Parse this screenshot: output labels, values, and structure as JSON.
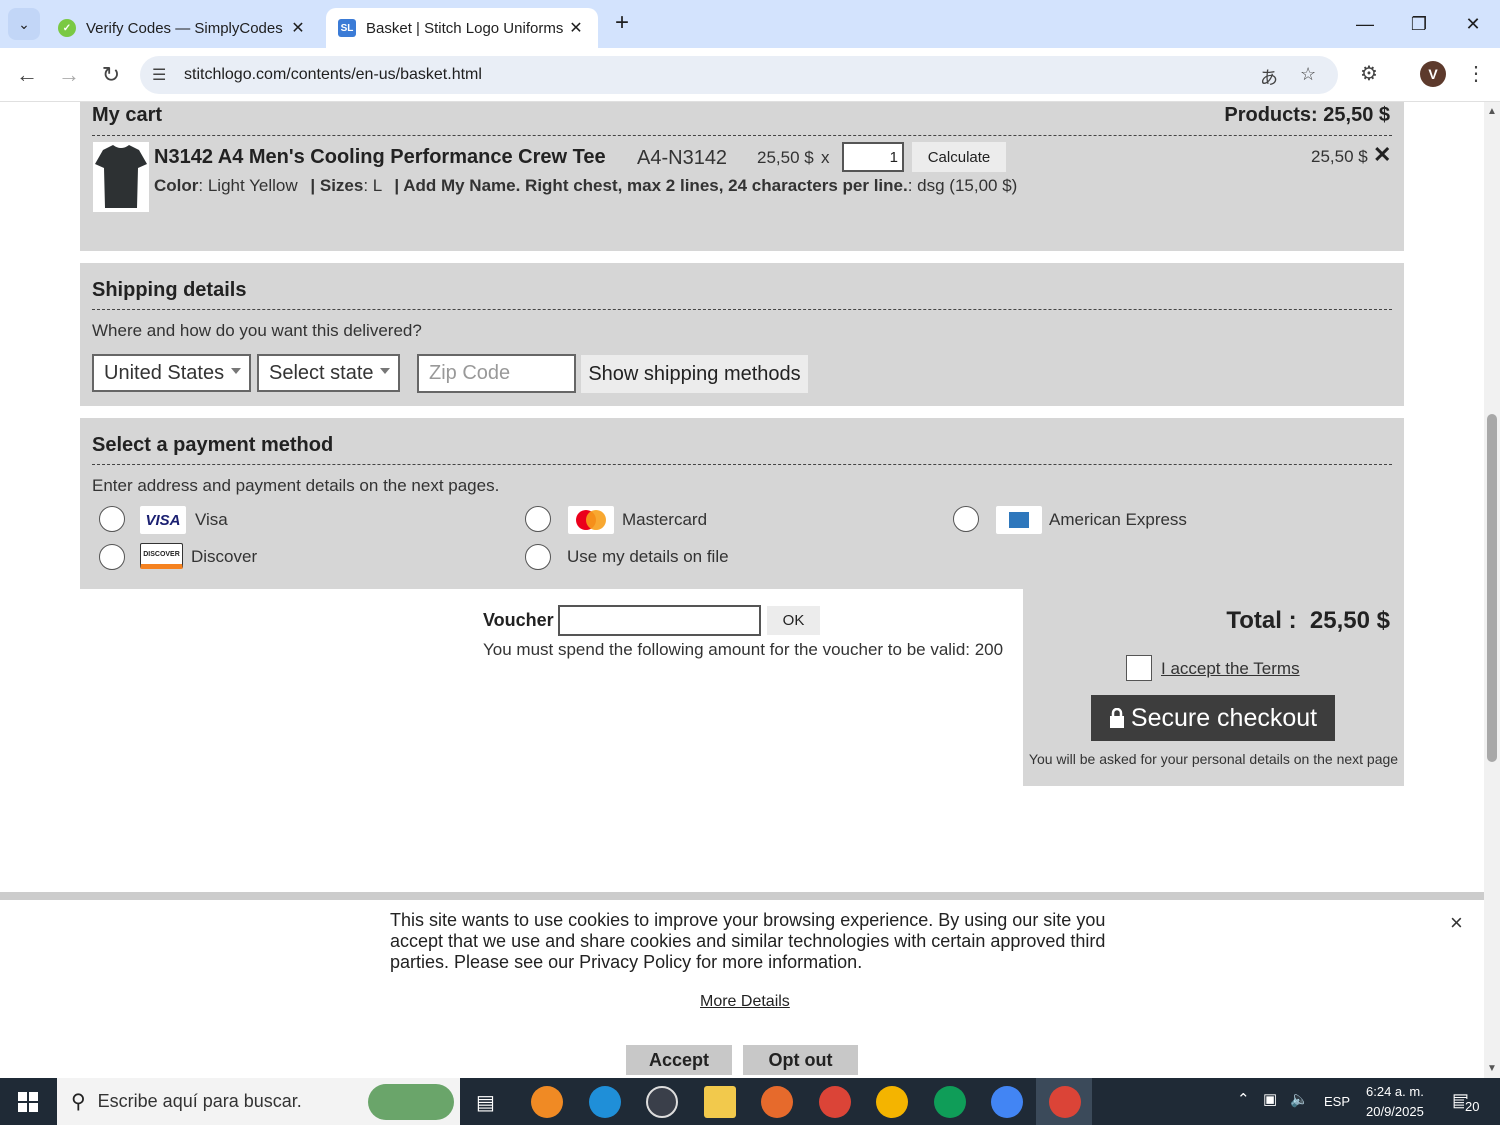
{
  "browser": {
    "tabs": [
      {
        "title": "Verify Codes — SimplyCodes",
        "close": "✕",
        "favicon": "simplycodes-icon"
      },
      {
        "title": "Basket | Stitch Logo Uniforms",
        "close": "✕",
        "favicon": "SL"
      }
    ],
    "new_tab": "+",
    "url": "stitchlogo.com/contents/en-us/basket.html",
    "avatar_letter": "V",
    "window_controls": [
      "minimize-icon",
      "restore-icon",
      "close-icon"
    ]
  },
  "cart": {
    "title": "My cart",
    "products_total": "Products: 25,50 $",
    "item": {
      "name": "N3142 A4 Men's Cooling Performance Crew Tee",
      "code": "A4-N3142",
      "unit_price": "25,50 $",
      "times": "x",
      "quantity": "1",
      "calculate_label": "Calculate",
      "line_total": "25,50 $",
      "remove": "✕",
      "color_label": "Color",
      "color_value": ": Light Yellow",
      "sizes_label": "| Sizes",
      "sizes_value": ": L",
      "addon_label": "| Add My Name. Right chest, max 2 lines, 24 characters per line.",
      "addon_value": ": dsg (15,00 $)"
    }
  },
  "shipping": {
    "title": "Shipping details",
    "prompt": "Where and how do you want this delivered?",
    "country": "United States",
    "state": "Select state",
    "zip_placeholder": "Zip Code",
    "show_methods": "Show shipping methods"
  },
  "payment": {
    "title": "Select a payment method",
    "prompt": "Enter address and payment details on the next pages.",
    "methods": [
      {
        "label": "Visa",
        "logo": "VISA"
      },
      {
        "label": "Mastercard",
        "logo": "mastercard-logo"
      },
      {
        "label": "American Express",
        "logo": "amex-logo"
      },
      {
        "label": "Discover",
        "logo": "DISCOVER"
      },
      {
        "label": "Use my details on file"
      }
    ]
  },
  "voucher": {
    "label": "Voucher",
    "ok": "OK",
    "note": "You must spend the following amount for the voucher to be valid: 200"
  },
  "summary": {
    "total_label": "Total :",
    "total_value": "25,50 $",
    "terms": "I accept the Terms",
    "checkout": "Secure checkout",
    "checkout_note": "You will be asked for your personal details on the next page"
  },
  "cookie": {
    "text_line1": "This site wants to use cookies to improve your browsing experience. By using our site you",
    "text_line2": "accept that we use and share cookies and similar technologies with certain approved third",
    "text_line3": "parties. Please see our Privacy Policy for more information.",
    "more": "More Details",
    "accept": "Accept",
    "optout": "Opt out",
    "close": "×"
  },
  "taskbar": {
    "search_placeholder": "Escribe aquí para buscar.",
    "lang": "ESP",
    "time": "6:24 a. m.",
    "date": "20/9/2025",
    "notifications": "20"
  }
}
